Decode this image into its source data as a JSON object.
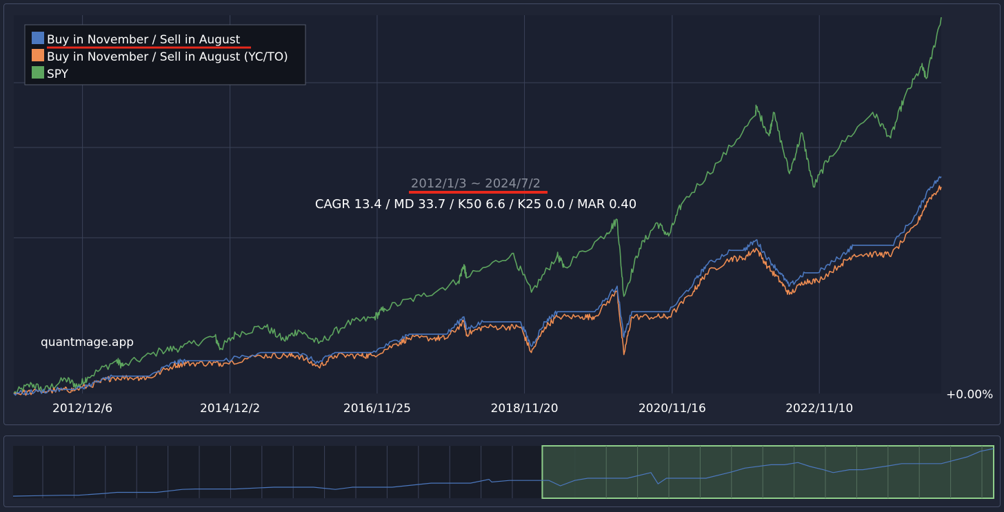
{
  "chart_data": {
    "type": "line",
    "title": "",
    "date_range": "2012/1/3 ~ 2024/7/2",
    "stats": "CAGR 13.4 / MD 33.7 / K50 6.6 / K25 0.0 / MAR 0.40",
    "watermark": "quantmage.app",
    "y_axis_label": "+0.00%",
    "x_ticks": [
      "2012/12/6",
      "2014/12/2",
      "2016/11/25",
      "2018/11/20",
      "2020/11/16",
      "2022/11/10"
    ],
    "legend_position": "top-left",
    "grid": true,
    "series": [
      {
        "name": "Buy in November / Sell in August",
        "color": "#4c78bf",
        "x": [
          "2012/1/3",
          "2012/5/1",
          "2012/8/31",
          "2012/11/1",
          "2013/3/1",
          "2013/5/1",
          "2013/8/31",
          "2013/11/1",
          "2014/3/1",
          "2014/5/1",
          "2014/8/31",
          "2014/11/1",
          "2015/5/1",
          "2015/8/31",
          "2015/11/1",
          "2016/2/11",
          "2016/5/1",
          "2016/8/31",
          "2016/11/1",
          "2017/3/1",
          "2017/5/1",
          "2017/8/31",
          "2017/11/1",
          "2018/1/26",
          "2018/2/8",
          "2018/5/1",
          "2018/8/31",
          "2018/11/1",
          "2018/12/24",
          "2019/3/1",
          "2019/5/1",
          "2019/8/31",
          "2019/11/1",
          "2020/2/19",
          "2020/3/23",
          "2020/5/1",
          "2020/8/31",
          "2020/11/1",
          "2021/3/1",
          "2021/5/1",
          "2021/8/31",
          "2021/11/1",
          "2022/1/3",
          "2022/3/1",
          "2022/5/1",
          "2022/6/16",
          "2022/8/31",
          "2022/11/1",
          "2023/3/1",
          "2023/5/1",
          "2023/8/31",
          "2023/11/1",
          "2024/3/1",
          "2024/5/1",
          "2024/7/2"
        ],
        "y": [
          0,
          2,
          4,
          4,
          12,
          17,
          17,
          17,
          30,
          32,
          32,
          32,
          40,
          40,
          40,
          30,
          40,
          40,
          40,
          52,
          58,
          58,
          58,
          75,
          63,
          70,
          70,
          70,
          46,
          70,
          80,
          80,
          80,
          105,
          55,
          80,
          80,
          80,
          108,
          125,
          140,
          140,
          150,
          132,
          118,
          105,
          118,
          118,
          135,
          145,
          145,
          145,
          175,
          200,
          212
        ]
      },
      {
        "name": "Buy in November / Sell in August (YC/TO)",
        "color": "#ef8d52",
        "x": [
          "2012/1/3",
          "2012/5/1",
          "2012/8/31",
          "2012/11/1",
          "2013/3/1",
          "2013/5/1",
          "2013/8/31",
          "2013/11/1",
          "2014/3/1",
          "2014/5/1",
          "2014/8/31",
          "2014/11/1",
          "2015/5/1",
          "2015/8/31",
          "2015/11/1",
          "2016/2/11",
          "2016/5/1",
          "2016/8/31",
          "2016/11/1",
          "2017/3/1",
          "2017/5/1",
          "2017/8/31",
          "2017/11/1",
          "2018/1/26",
          "2018/2/8",
          "2018/5/1",
          "2018/8/31",
          "2018/11/1",
          "2018/12/24",
          "2019/3/1",
          "2019/5/1",
          "2019/8/31",
          "2019/11/1",
          "2020/2/19",
          "2020/3/23",
          "2020/5/1",
          "2020/8/31",
          "2020/11/1",
          "2021/3/1",
          "2021/5/1",
          "2021/8/31",
          "2021/11/1",
          "2022/1/3",
          "2022/3/1",
          "2022/5/1",
          "2022/6/16",
          "2022/8/31",
          "2022/11/1",
          "2023/3/1",
          "2023/5/1",
          "2023/8/31",
          "2023/11/1",
          "2024/3/1",
          "2024/5/1",
          "2024/7/2"
        ],
        "y": [
          0,
          1.8,
          3.5,
          3.5,
          11,
          15.5,
          15.5,
          15.5,
          27.5,
          29.5,
          29.5,
          29.5,
          37,
          37,
          37,
          26,
          37,
          37,
          37,
          48.5,
          54,
          54,
          54,
          70,
          58,
          65,
          65,
          65,
          40,
          65,
          75,
          75,
          75,
          100,
          38,
          75,
          75,
          75,
          100,
          117,
          132,
          132,
          142,
          124,
          110,
          97,
          110,
          110,
          127,
          136,
          136,
          136,
          165,
          190,
          202
        ]
      },
      {
        "name": "SPY",
        "color": "#5ea65f",
        "x": [
          "2012/1/3",
          "2012/4/1",
          "2012/6/1",
          "2012/9/14",
          "2012/11/15",
          "2013/1/1",
          "2013/5/21",
          "2013/6/24",
          "2013/12/31",
          "2014/4/11",
          "2014/9/18",
          "2014/10/15",
          "2014/12/31",
          "2015/5/21",
          "2015/8/25",
          "2015/11/3",
          "2016/2/11",
          "2016/6/27",
          "2016/11/8",
          "2016/12/31",
          "2017/6/30",
          "2017/12/31",
          "2018/1/26",
          "2018/2/8",
          "2018/9/20",
          "2018/12/24",
          "2019/4/30",
          "2019/6/3",
          "2019/12/31",
          "2020/2/19",
          "2020/3/23",
          "2020/6/8",
          "2020/9/2",
          "2020/10/30",
          "2020/12/31",
          "2021/6/30",
          "2021/12/31",
          "2022/1/3",
          "2022/3/8",
          "2022/3/29",
          "2022/6/16",
          "2022/8/16",
          "2022/10/12",
          "2022/12/31",
          "2023/7/31",
          "2023/10/27",
          "2023/12/31",
          "2024/3/28",
          "2024/4/19",
          "2024/7/2"
        ],
        "y": [
          0,
          9,
          3,
          14,
          7,
          16,
          32,
          27,
          42,
          45,
          56,
          44,
          58,
          66,
          52,
          62,
          49,
          68,
          74,
          83,
          95,
          110,
          126,
          113,
          137,
          99,
          135,
          124,
          157,
          170,
          95,
          142,
          167,
          154,
          185,
          226,
          272,
          280,
          252,
          275,
          215,
          255,
          202,
          232,
          275,
          250,
          288,
          320,
          308,
          368
        ]
      }
    ],
    "navigator": {
      "series_name": "Buy in November / Sell in August",
      "selected_range": [
        "2018/10/1",
        "2024/7/2"
      ]
    }
  }
}
